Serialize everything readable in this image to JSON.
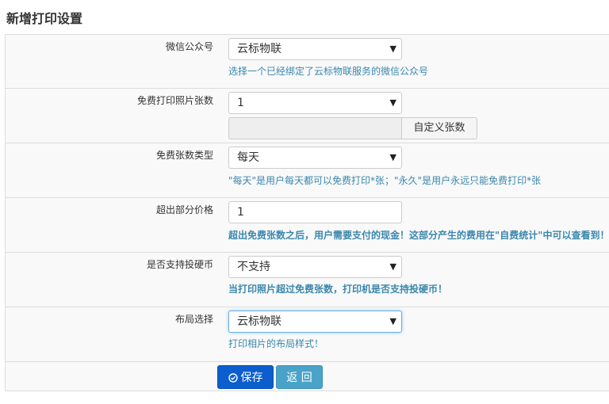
{
  "page": {
    "title": "新增打印设置"
  },
  "fields": {
    "wechat": {
      "label": "微信公众号",
      "value": "云标物联",
      "help": "选择一个已经绑定了云标物联服务的微信公众号"
    },
    "free_count": {
      "label": "免费打印照片张数",
      "value": "1",
      "custom_button": "自定义张数"
    },
    "free_type": {
      "label": "免费张数类型",
      "value": "每天",
      "help": "\"每天\"是用户每天都可以免费打印*张；\"永久\"是用户永远只能免费打印*张"
    },
    "overflow_price": {
      "label": "超出部分价格",
      "value": "1",
      "help": "超出免费张数之后，用户需要支付的现金！这部分产生的费用在\"自费统计\"中可以查看到！"
    },
    "coin": {
      "label": "是否支持投硬币",
      "value": "不支持",
      "help": "当打印照片超过免费张数，打印机是否支持投硬币！"
    },
    "layout": {
      "label": "布局选择",
      "value": "云标物联",
      "help": "打印相片的布局样式！"
    }
  },
  "actions": {
    "save_label": "保存",
    "back_label": "返 回"
  },
  "colors": {
    "primary": "#0c5ecf",
    "info": "#49a3c8",
    "help_text": "#3a87ad"
  }
}
